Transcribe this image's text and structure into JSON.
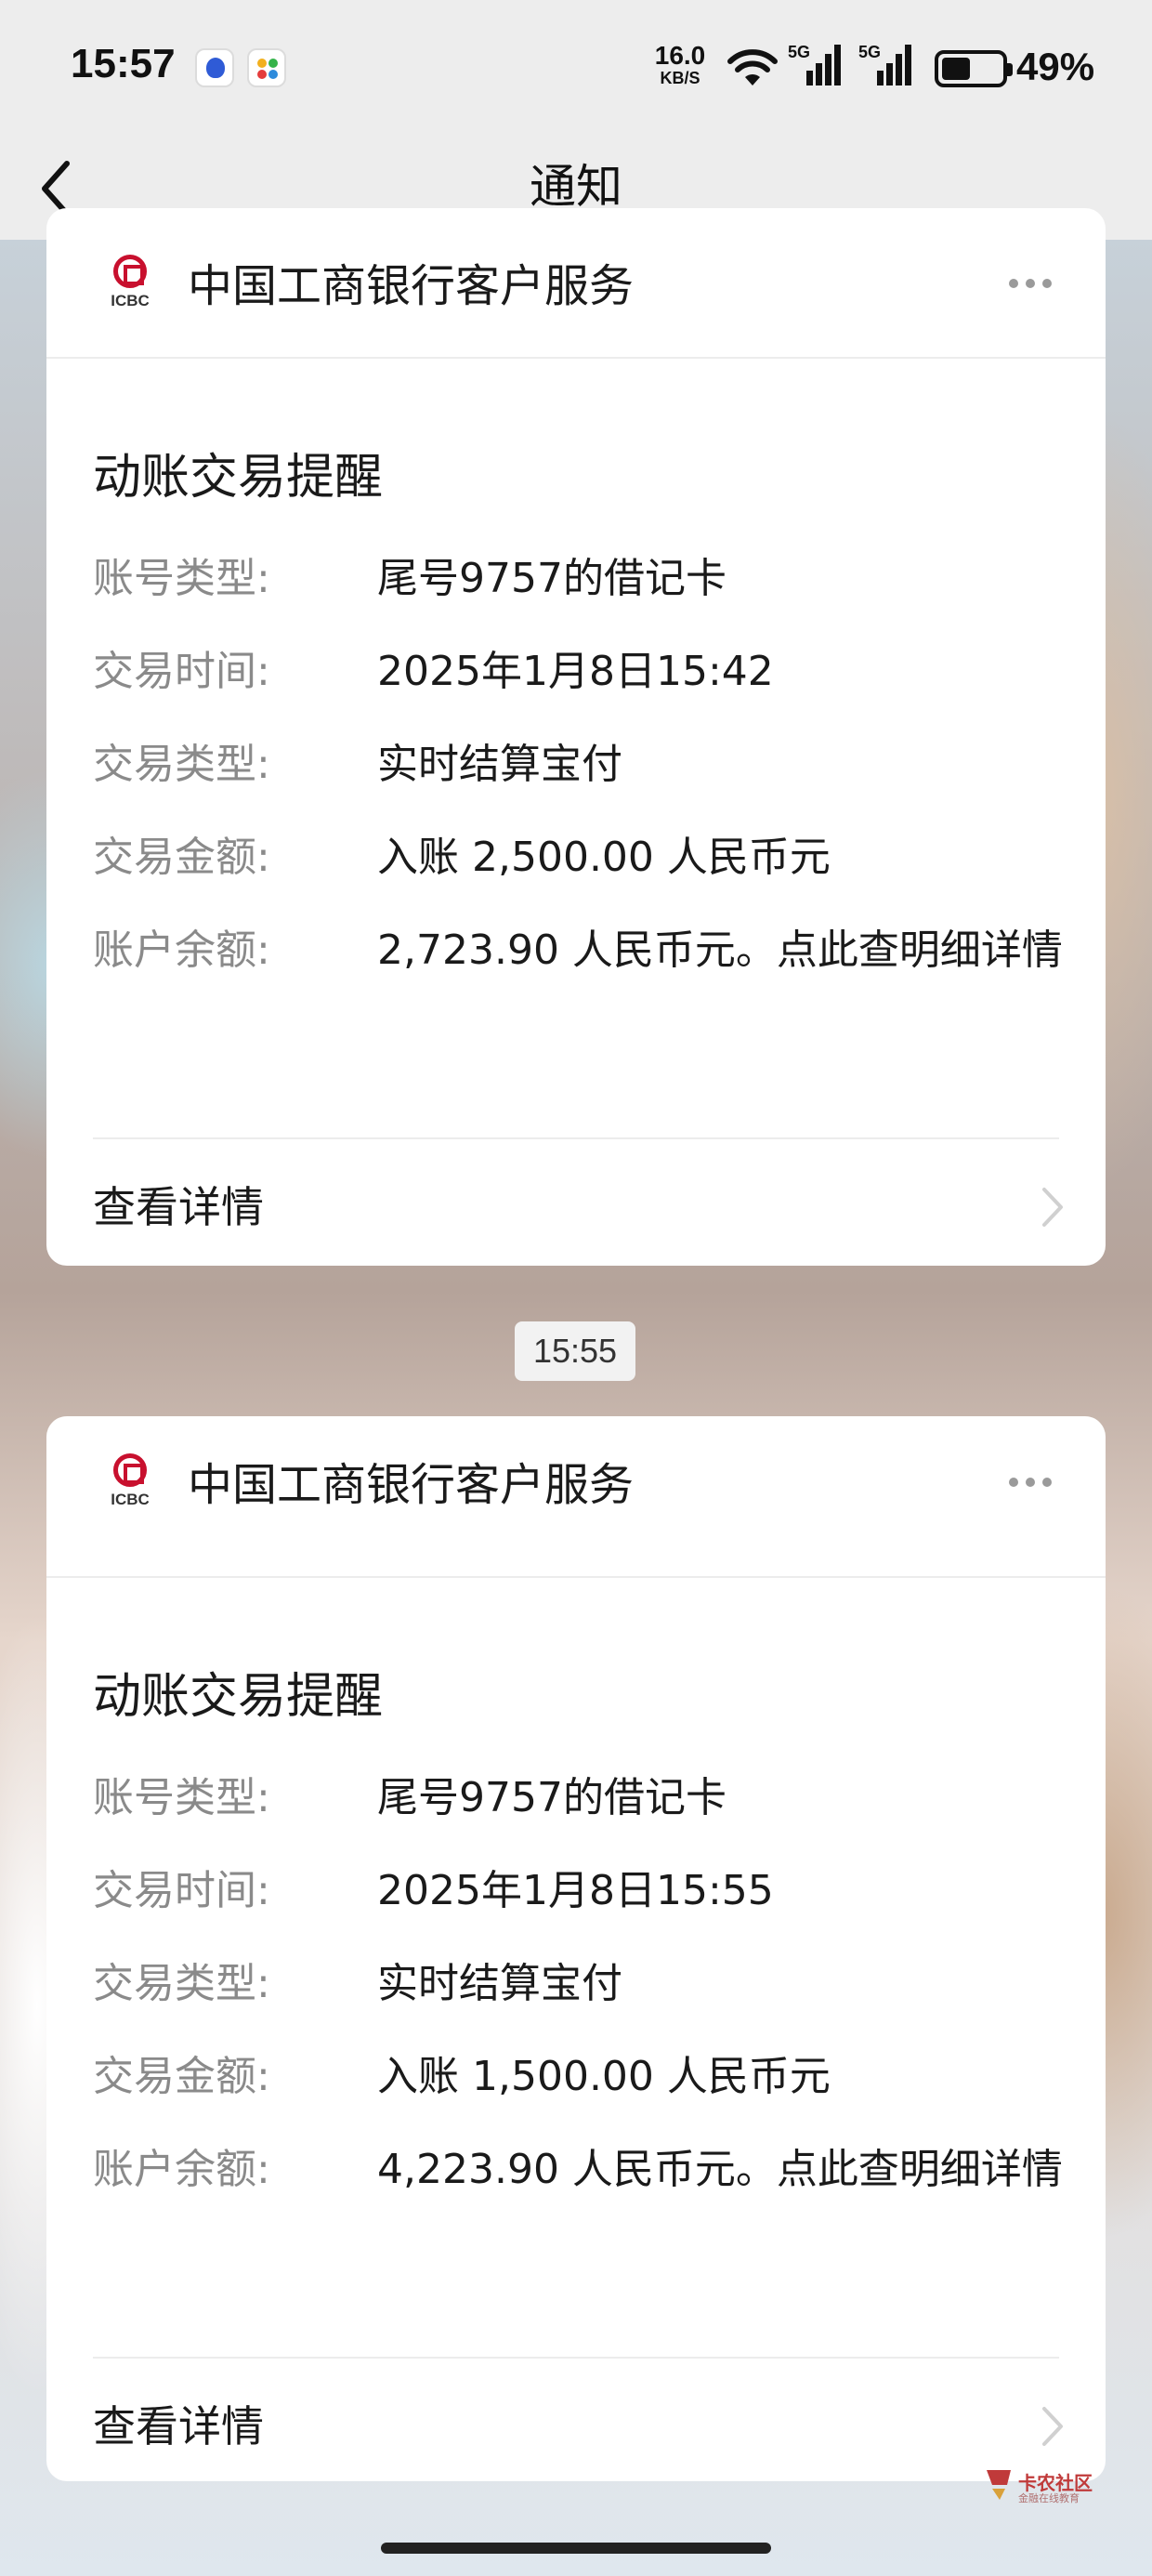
{
  "status_bar": {
    "time": "15:57",
    "net_speed_value": "16.0",
    "net_speed_unit": "KB/S",
    "signal1_tag": "5G",
    "signal2_tag": "5G",
    "battery_percent": "49%",
    "battery_level": 0.49,
    "icons": [
      "baidu-app-icon",
      "game-center-icon",
      "wifi-icon",
      "signal-icon",
      "battery-icon"
    ]
  },
  "nav": {
    "title": "通知",
    "back_icon": "chevron-left-icon"
  },
  "notifications": [
    {
      "sender": "中国工商银行客户服务",
      "logo_text": "ICBC",
      "title": "动账交易提醒",
      "fields": [
        {
          "label": "账号类型:",
          "value": "尾号9757的借记卡"
        },
        {
          "label": "交易时间:",
          "value": "2025年1月8日15:42"
        },
        {
          "label": "交易类型:",
          "value": "实时结算宝付"
        },
        {
          "label": "交易金额:",
          "value": "入账 2,500.00 人民币元"
        },
        {
          "label": "账户余额:",
          "value": "2,723.90 人民币元。点此查明细详情"
        }
      ],
      "detail_link": "查看详情"
    },
    {
      "sender": "中国工商银行客户服务",
      "logo_text": "ICBC",
      "title": "动账交易提醒",
      "fields": [
        {
          "label": "账号类型:",
          "value": "尾号9757的借记卡"
        },
        {
          "label": "交易时间:",
          "value": "2025年1月8日15:55"
        },
        {
          "label": "交易类型:",
          "value": "实时结算宝付"
        },
        {
          "label": "交易金额:",
          "value": "入账 1,500.00 人民币元"
        },
        {
          "label": "账户余额:",
          "value": "4,223.90 人民币元。点此查明细详情"
        }
      ],
      "detail_link": "查看详情"
    }
  ],
  "timestamp_divider": "15:55",
  "watermark": {
    "text": "卡农社区",
    "sub": "金融在线教育"
  },
  "colors": {
    "icbc_red": "#c8102e",
    "bar_bg": "#ededed",
    "label_gray": "#8a8a8a"
  }
}
